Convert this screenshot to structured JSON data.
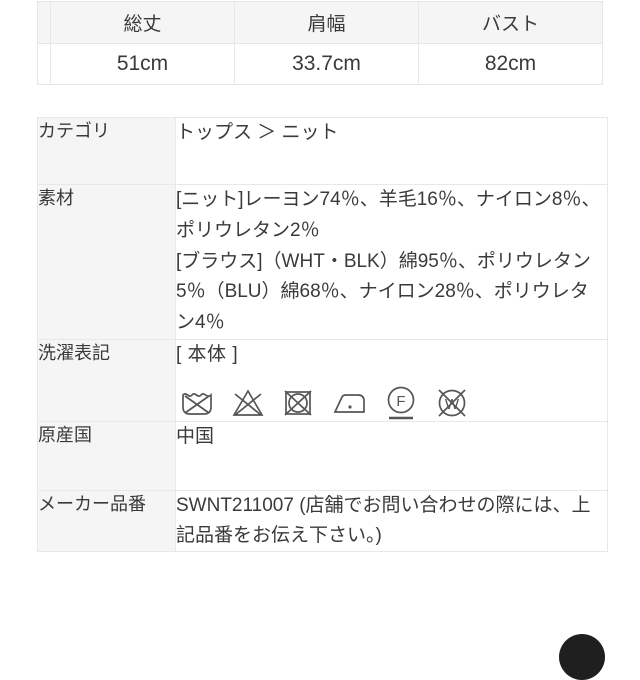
{
  "size_table": {
    "columns": [
      "総丈",
      "肩幅",
      "バスト"
    ],
    "values": [
      "51cm",
      "33.7cm",
      "82cm"
    ]
  },
  "spec_table": {
    "rows": [
      {
        "label": "カテゴリ",
        "value": "トップス ＞ ニット"
      },
      {
        "label": "素材",
        "value": ""
      },
      {
        "label": "洗濯表記",
        "value": ""
      },
      {
        "label": "原産国",
        "value": "中国"
      },
      {
        "label": "メーカー品番",
        "value": "SWNT211007 (店舗でお問い合わせの際には、上記品番をお伝え下さい。)"
      }
    ],
    "material": {
      "line1": "[ニット]レーヨン74％、羊毛16％、ナイロン8％、ポリウレタン2％",
      "line2": "[ブラウス]（WHT・BLK）綿95％、ポリウレタン5％（BLU）綿68％、ナイロン28％、ポリウレタン4％"
    },
    "care": {
      "heading": "[ 本体 ]",
      "symbols": [
        {
          "name": "do-not-wash-icon",
          "label": "家庭での洗濯禁止"
        },
        {
          "name": "do-not-bleach-icon",
          "label": "漂白禁止"
        },
        {
          "name": "do-not-tumble-dry-icon",
          "label": "タンブル乾燥禁止"
        },
        {
          "name": "iron-low-icon",
          "label": "低温アイロン"
        },
        {
          "name": "dryclean-petroleum-icon",
          "label": "石油系ドライクリーニング弱",
          "letter": "F"
        },
        {
          "name": "do-not-wet-clean-icon",
          "label": "ウエットクリーニング禁止",
          "letter": "W"
        }
      ]
    }
  },
  "colors": {
    "label_bg": "#f5f5f5",
    "border": "#e8e8e8",
    "text": "#3a3a3a",
    "symbol_stroke": "#565656",
    "fab_bg": "#1f1f1f"
  }
}
